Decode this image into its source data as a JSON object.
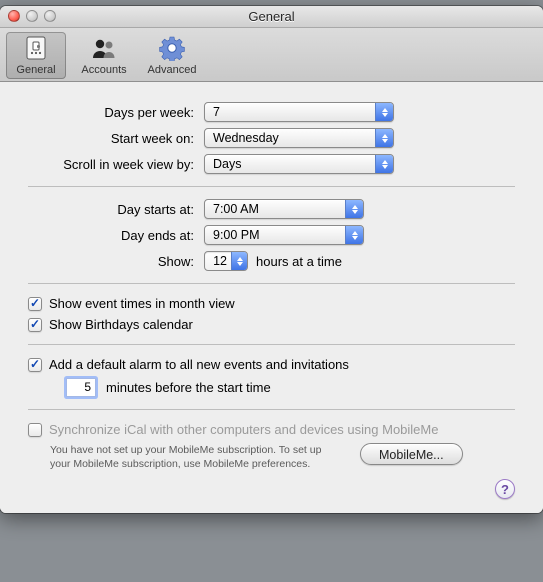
{
  "window": {
    "title": "General"
  },
  "toolbar": {
    "general": "General",
    "accounts": "Accounts",
    "advanced": "Advanced",
    "selected": "general"
  },
  "labels": {
    "days_per_week": "Days per week:",
    "start_week_on": "Start week on:",
    "scroll_week_view": "Scroll in week view by:",
    "day_starts": "Day starts at:",
    "day_ends": "Day ends at:",
    "show": "Show:",
    "hours_at_a_time": "hours at a time",
    "show_event_times": "Show event times in month view",
    "show_birthdays": "Show Birthdays calendar",
    "default_alarm": "Add a default alarm to all new events and invitations",
    "minutes_before": "minutes before the start time",
    "sync_mobileme": "Synchronize iCal with other computers and devices using MobileMe",
    "mobileme_info": "You have not set up your MobileMe subscription. To set up your MobileMe subscription, use MobileMe preferences.",
    "mobileme_btn": "MobileMe...",
    "help": "?"
  },
  "values": {
    "days_per_week": "7",
    "start_week_on": "Wednesday",
    "scroll_week_view": "Days",
    "day_starts": "7:00 AM",
    "day_ends": "9:00 PM",
    "show_hours": "12",
    "alarm_minutes": "5"
  },
  "checks": {
    "show_event_times": true,
    "show_birthdays": true,
    "default_alarm": true,
    "sync_mobileme": false
  }
}
